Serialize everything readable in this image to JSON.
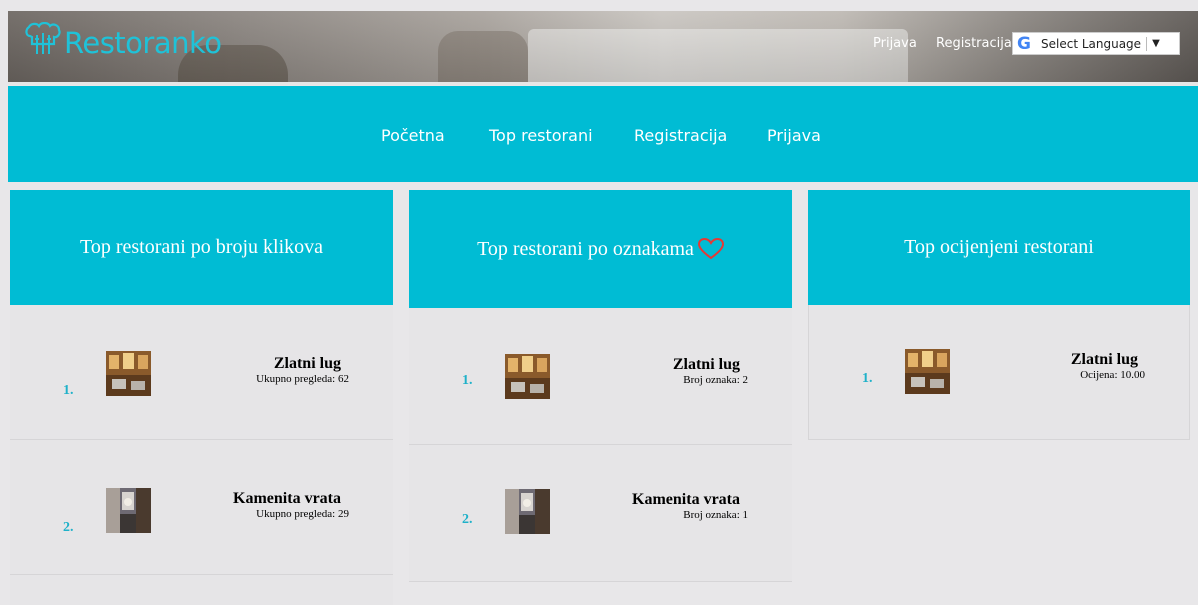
{
  "header": {
    "logo_text": "Restoranko",
    "login_link": "Prijava",
    "register_link": "Registracija",
    "language_selector": {
      "label": "Select Language",
      "arrow": "▼"
    }
  },
  "nav": {
    "items": [
      {
        "label": "Početna"
      },
      {
        "label": "Top restorani"
      },
      {
        "label": "Registracija"
      },
      {
        "label": "Prijava"
      }
    ]
  },
  "columns": [
    {
      "title": "Top restorani po broju klikova",
      "items": [
        {
          "rank": "1.",
          "name": "Zlatni lug",
          "stat": "Ukupno pregleda: 62"
        },
        {
          "rank": "2.",
          "name": "Kamenita vrata",
          "stat": "Ukupno pregleda: 29"
        }
      ]
    },
    {
      "title": "Top restorani po oznakama",
      "title_icon": "heart-outline-icon",
      "items": [
        {
          "rank": "1.",
          "name": "Zlatni lug",
          "stat": "Broj oznaka: 2"
        },
        {
          "rank": "2.",
          "name": "Kamenita vrata",
          "stat": "Broj oznaka: 1"
        }
      ]
    },
    {
      "title": "Top ocijenjeni restorani",
      "items": [
        {
          "rank": "1.",
          "name": "Zlatni lug",
          "stat": "Ocijena: 10.00"
        }
      ]
    }
  ],
  "colors": {
    "accent": "#00bcd4",
    "rank": "#1fb1c9",
    "heart": "#e53935",
    "background": "#e8e7e9"
  }
}
